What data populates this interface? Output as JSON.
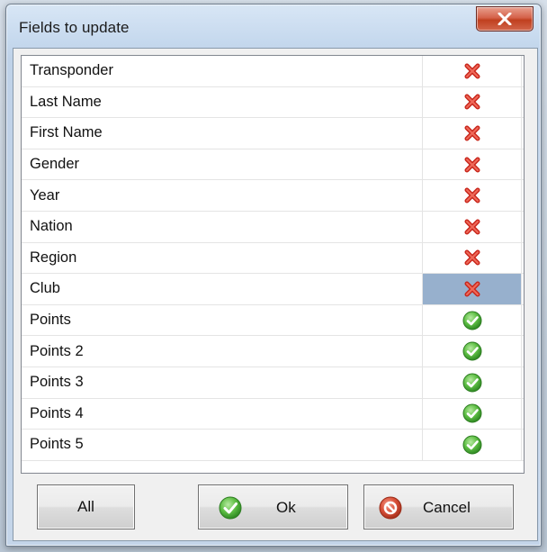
{
  "dialog": {
    "title": "Fields to update",
    "close_label": "Close"
  },
  "fields": [
    {
      "name": "Transponder",
      "status": "disabled",
      "icon": "red-x-icon"
    },
    {
      "name": "Last Name",
      "status": "disabled",
      "icon": "red-x-icon"
    },
    {
      "name": "First Name",
      "status": "disabled",
      "icon": "red-x-icon"
    },
    {
      "name": "Gender",
      "status": "disabled",
      "icon": "red-x-icon"
    },
    {
      "name": "Year",
      "status": "disabled",
      "icon": "red-x-icon"
    },
    {
      "name": "Nation",
      "status": "disabled",
      "icon": "red-x-icon"
    },
    {
      "name": "Region",
      "status": "disabled",
      "icon": "red-x-icon"
    },
    {
      "name": "Club",
      "status": "disabled",
      "icon": "red-x-icon",
      "selected": true
    },
    {
      "name": "Points",
      "status": "enabled",
      "icon": "green-check-icon"
    },
    {
      "name": "Points 2",
      "status": "enabled",
      "icon": "green-check-icon"
    },
    {
      "name": "Points 3",
      "status": "enabled",
      "icon": "green-check-icon"
    },
    {
      "name": "Points 4",
      "status": "enabled",
      "icon": "green-check-icon"
    },
    {
      "name": "Points 5",
      "status": "enabled",
      "icon": "green-check-icon"
    }
  ],
  "buttons": {
    "all_label": "All",
    "ok_label": "Ok",
    "cancel_label": "Cancel"
  },
  "colors": {
    "selection": "#97b0cd",
    "x_red": "#d9342b",
    "check_green": "#4caf3c",
    "cancel_red": "#d9513a"
  }
}
